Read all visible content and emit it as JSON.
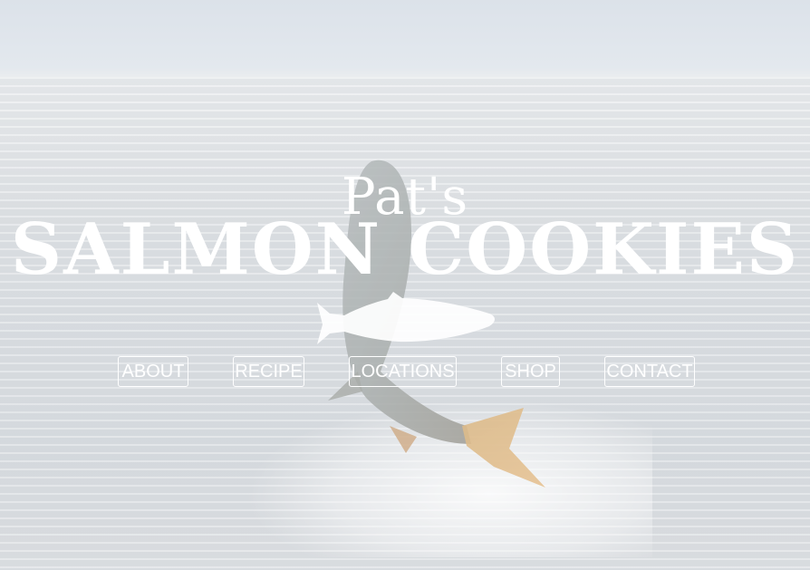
{
  "hero": {
    "pre_title": "Pat's",
    "title": "SALMON COOKIES",
    "logo_icon": "salmon-fish-icon"
  },
  "nav": {
    "items": [
      {
        "label": "ABOUT"
      },
      {
        "label": "RECIPE"
      },
      {
        "label": "LOCATIONS"
      },
      {
        "label": "SHOP"
      },
      {
        "label": "CONTACT"
      }
    ]
  },
  "colors": {
    "text": "#ffffff",
    "sky": "#cfd8e2",
    "water": "#c9cfd5"
  }
}
